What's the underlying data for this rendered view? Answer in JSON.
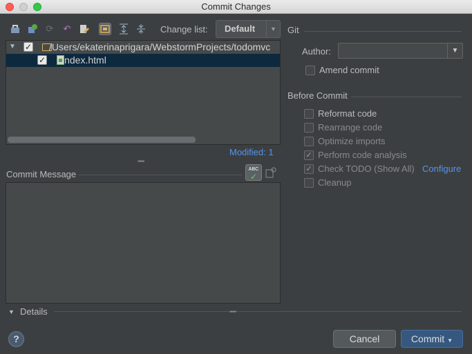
{
  "window": {
    "title": "Commit Changes"
  },
  "toolbar": {
    "icons": [
      "commit-icon",
      "update-icon",
      "refresh-icon",
      "revert-icon",
      "edit-icon",
      "group-icon",
      "expand-all-icon",
      "collapse-all-icon"
    ],
    "changelist_label": "Change list:",
    "changelist_value": "Default"
  },
  "tree": {
    "rows": [
      {
        "label": "/Users/ekaterinaprigara/WebstormProjects/todomvc",
        "checked": true
      },
      {
        "label": "index.html",
        "checked": true
      }
    ]
  },
  "modified_label": "Modified: 1",
  "commit_message": {
    "label": "Commit Message",
    "value": ""
  },
  "details_label": "Details",
  "git": {
    "section_label": "Git",
    "author_label": "Author:",
    "author_value": "",
    "amend_label": "Amend commit"
  },
  "before_commit": {
    "section_label": "Before Commit",
    "options": [
      {
        "label": "Reformat code",
        "checked": false,
        "enabled": true
      },
      {
        "label": "Rearrange code",
        "checked": false,
        "enabled": false
      },
      {
        "label": "Optimize imports",
        "checked": false,
        "enabled": false
      },
      {
        "label": "Perform code analysis",
        "checked": true,
        "enabled": false
      },
      {
        "label": "Check TODO (Show All)",
        "checked": true,
        "enabled": false
      },
      {
        "label": "Cleanup",
        "checked": false,
        "enabled": false
      }
    ],
    "configure_label": "Configure"
  },
  "buttons": {
    "help": "?",
    "cancel": "Cancel",
    "commit": "Commit"
  },
  "colors": {
    "background": "#3c3f41",
    "selection": "#0d293e",
    "link": "#5394ec",
    "commit_button": "#365880"
  }
}
